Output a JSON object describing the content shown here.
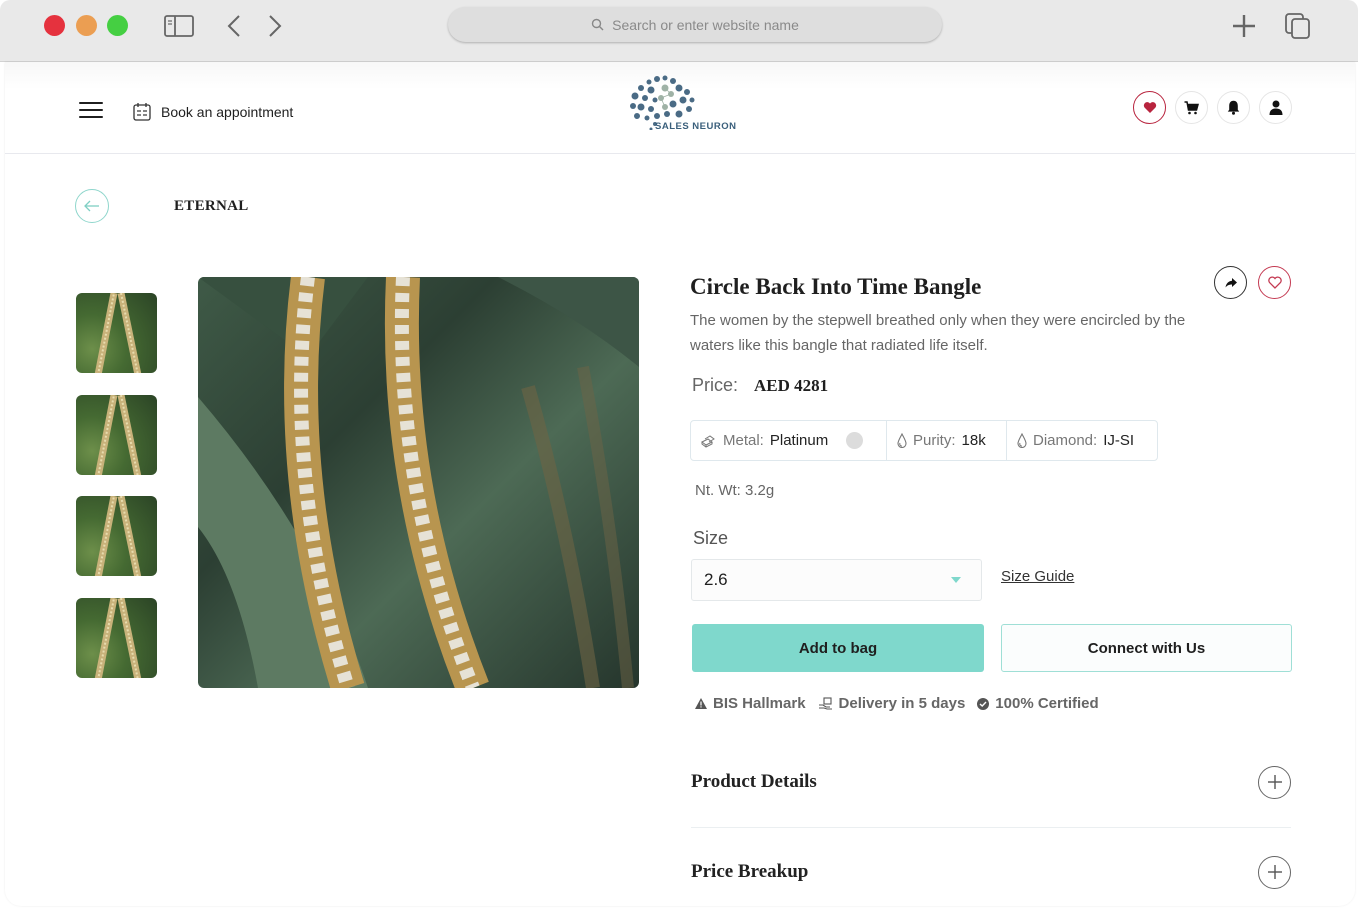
{
  "browser": {
    "address_placeholder": "Search or enter website name",
    "buttons": [
      "sidebar-toggle",
      "back",
      "forward",
      "new-tab",
      "show-tabs"
    ]
  },
  "header": {
    "appointment_label": "Book an appointment",
    "logo_text": "SALES NEURON",
    "icons": [
      "heart-icon",
      "cart-icon",
      "bell-icon",
      "user-icon"
    ]
  },
  "breadcrumb": {
    "collection": "ETERNAL"
  },
  "gallery": {
    "thumbnail_count": 4
  },
  "product": {
    "title": "Circle Back Into Time Bangle",
    "description": "The women by the stepwell breathed only when they were encircled by the waters like this bangle that radiated life itself.",
    "price_label": "Price:",
    "price": "AED 4281",
    "specs": [
      {
        "label": "Metal:",
        "value": "Platinum"
      },
      {
        "label": "Purity:",
        "value": "18k"
      },
      {
        "label": "Diamond:",
        "value": "IJ-SI"
      }
    ],
    "net_weight": "Nt. Wt: 3.2g",
    "size_label": "Size",
    "size_selected": "2.6",
    "size_guide": "Size Guide",
    "add_to_bag": "Add to bag",
    "connect": "Connect with Us",
    "badges": [
      "BIS Hallmark",
      "Delivery in 5 days",
      "100% Certified"
    ]
  },
  "accordions": [
    {
      "title": "Product Details"
    },
    {
      "title": "Price Breakup"
    }
  ],
  "colors": {
    "accent": "#7fd8cc",
    "wishlist": "#b8243e",
    "logo": "#3a5f7b"
  }
}
